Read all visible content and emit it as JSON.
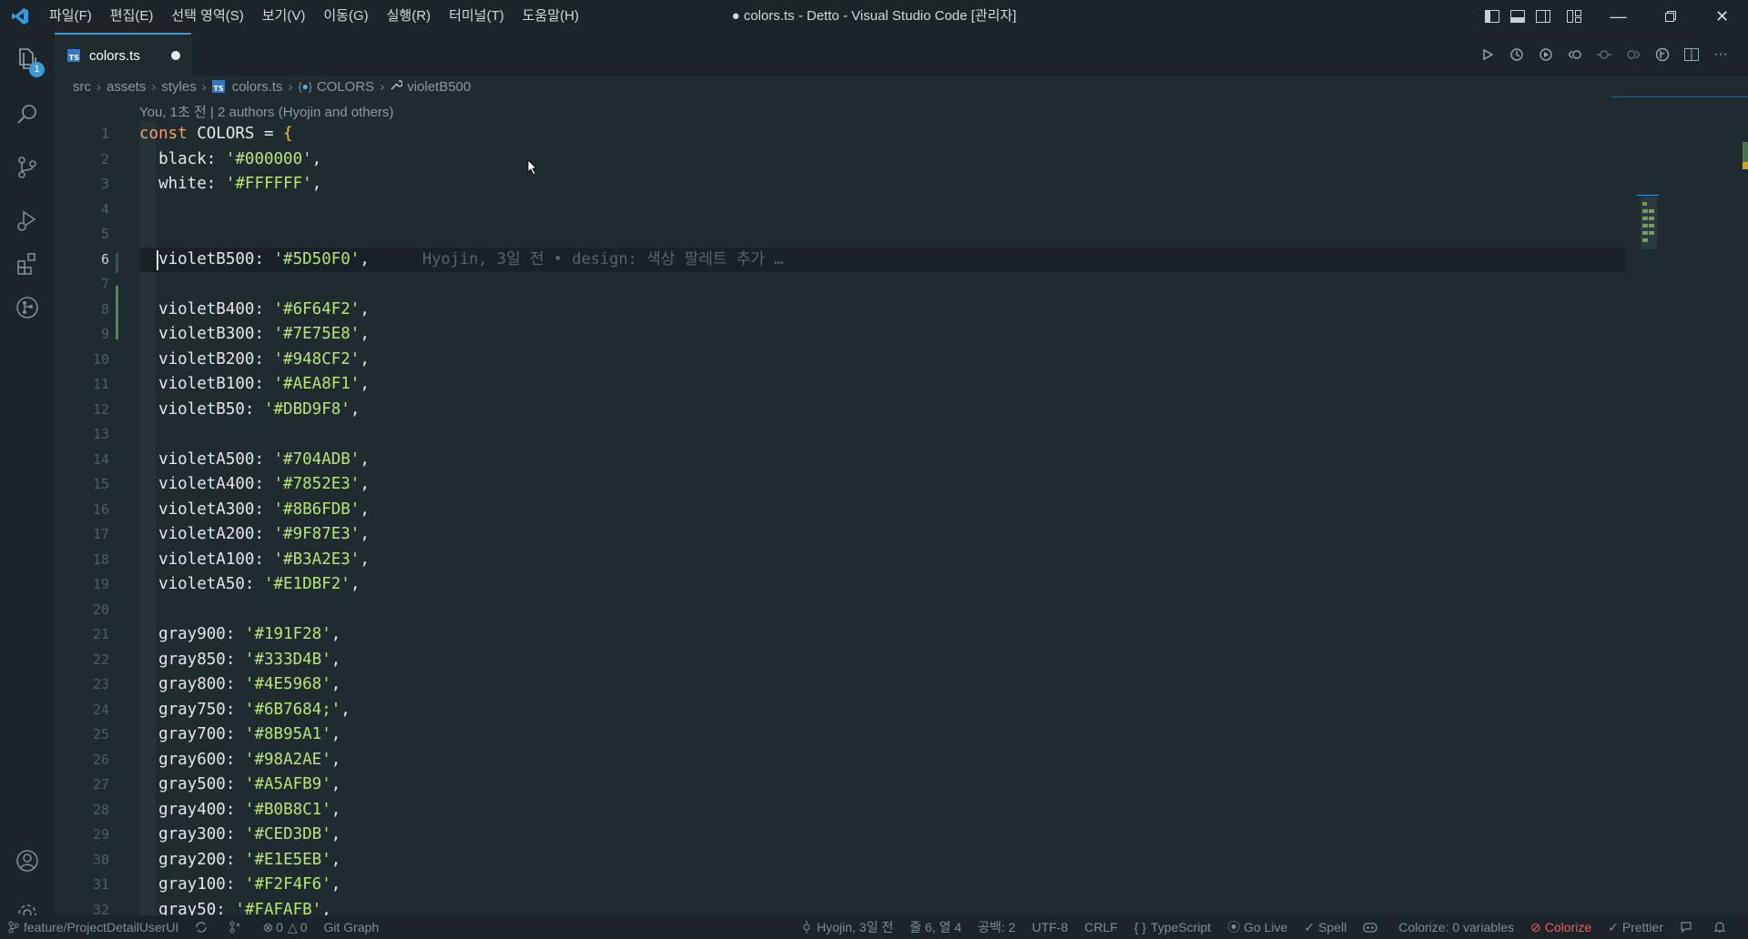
{
  "window": {
    "title": "● colors.ts - Detto - Visual Studio Code [관리자]",
    "menu": [
      "파일(F)",
      "편집(E)",
      "선택 영역(S)",
      "보기(V)",
      "이동(G)",
      "실행(R)",
      "터미널(T)",
      "도움말(H)"
    ]
  },
  "activity": {
    "explorer_badge": "1"
  },
  "tab": {
    "label": "colors.ts",
    "icon_text": "TS"
  },
  "breadcrumb": [
    "src",
    "assets",
    "styles",
    "colors.ts",
    "COLORS",
    "violetB500"
  ],
  "blame_header": "You, 1초 전 | 2 authors (Hyojin and others)",
  "inline_blame": "Hyojin, 3일 전 • design: 색상 팔레트 추가 …",
  "line_numbers": [
    "1",
    "2",
    "3",
    "4",
    "5",
    "6",
    "7",
    "8",
    "9",
    "10",
    "11",
    "12",
    "13",
    "14",
    "15",
    "16",
    "17",
    "18",
    "19",
    "20",
    "21",
    "22",
    "23",
    "24",
    "25",
    "26",
    "27",
    "28",
    "29",
    "30",
    "31",
    "32"
  ],
  "code": {
    "header": {
      "kw": "const",
      "name": " COLORS = ",
      "brace": "{"
    },
    "entries": [
      {
        "key": "black",
        "val": "'#000000'"
      },
      {
        "key": "white",
        "val": "'#FFFFFF'"
      },
      null,
      null,
      {
        "key": "violetB500",
        "val": "'#5D50F0'"
      },
      null,
      {
        "key": "violetB400",
        "val": "'#6F64F2'"
      },
      {
        "key": "violetB300",
        "val": "'#7E75E8'"
      },
      {
        "key": "violetB200",
        "val": "'#948CF2'"
      },
      {
        "key": "violetB100",
        "val": "'#AEA8F1'"
      },
      {
        "key": "violetB50",
        "val": "'#DBD9F8'"
      },
      null,
      {
        "key": "violetA500",
        "val": "'#704ADB'"
      },
      {
        "key": "violetA400",
        "val": "'#7852E3'"
      },
      {
        "key": "violetA300",
        "val": "'#8B6FDB'"
      },
      {
        "key": "violetA200",
        "val": "'#9F87E3'"
      },
      {
        "key": "violetA100",
        "val": "'#B3A2E3'"
      },
      {
        "key": "violetA50",
        "val": "'#E1DBF2'"
      },
      null,
      {
        "key": "gray900",
        "val": "'#191F28'"
      },
      {
        "key": "gray850",
        "val": "'#333D4B'"
      },
      {
        "key": "gray800",
        "val": "'#4E5968'"
      },
      {
        "key": "gray750",
        "val": "'#6B7684;'"
      },
      {
        "key": "gray700",
        "val": "'#8B95A1'"
      },
      {
        "key": "gray600",
        "val": "'#98A2AE'"
      },
      {
        "key": "gray500",
        "val": "'#A5AFB9'"
      },
      {
        "key": "gray400",
        "val": "'#B0B8C1'"
      },
      {
        "key": "gray300",
        "val": "'#CED3DB'"
      },
      {
        "key": "gray200",
        "val": "'#E1E5EB'"
      },
      {
        "key": "gray100",
        "val": "'#F2F4F6'"
      },
      {
        "key": "gray50",
        "val": "'#FAFAFB'"
      }
    ]
  },
  "status": {
    "branch": "feature/ProjectDetailUserUI",
    "problems": "0",
    "warnings": "0",
    "git_graph": "Git Graph",
    "blame": "Hyojin, 3일 전",
    "position": "줄 6, 열 4",
    "spaces": "공백: 2",
    "encoding": "UTF-8",
    "eol": "CRLF",
    "language": "TypeScript",
    "golive": "Go Live",
    "spell": "Spell",
    "colorize_vars": "Colorize: 0 variables",
    "colorize": "Colorize",
    "prettier": "Prettier"
  }
}
